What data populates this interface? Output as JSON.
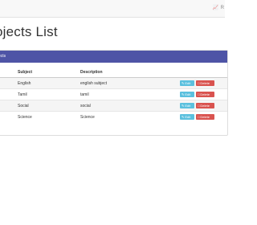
{
  "topbar": {
    "action_icon": "chart-icon",
    "action_label": "R"
  },
  "page": {
    "title": "ojects List"
  },
  "panel": {
    "heading": "ects"
  },
  "table": {
    "headers": [
      "",
      "Subject",
      "Description",
      ""
    ],
    "rows": [
      {
        "subject": "English",
        "description": "english subject"
      },
      {
        "subject": "Tamil",
        "description": "tamil"
      },
      {
        "subject": "Social",
        "description": "social"
      },
      {
        "subject": "Science",
        "description": "Science"
      }
    ],
    "edit_label": "Edit",
    "delete_label": "Delete"
  },
  "colors": {
    "panel_heading": "#4e54a6",
    "edit_button": "#5bc0de",
    "delete_button": "#d9534f"
  }
}
